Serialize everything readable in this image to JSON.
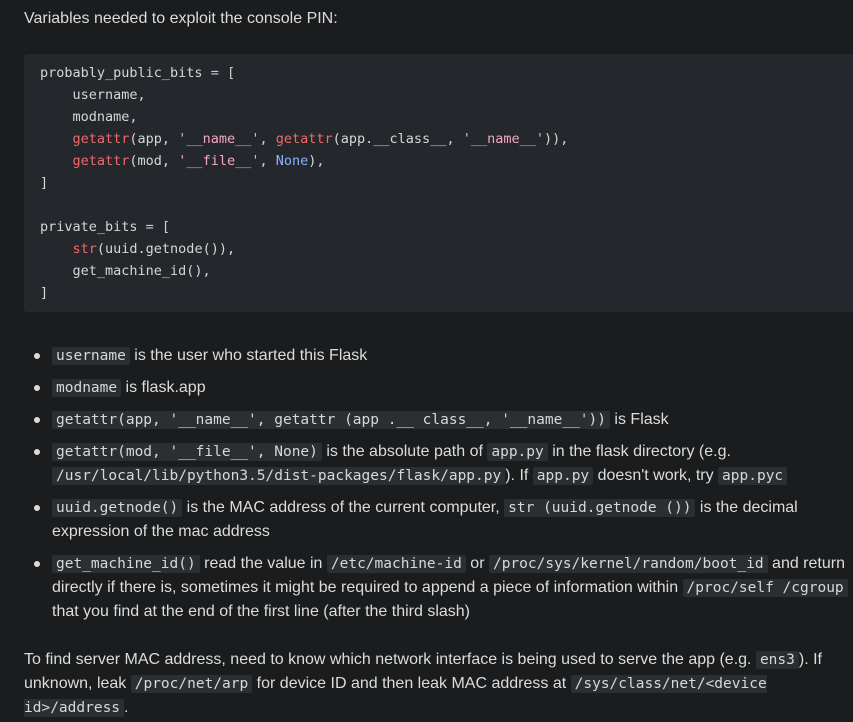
{
  "intro_text": "Variables needed to exploit the console PIN:",
  "code_lines": [
    [
      {
        "t": "probably_public_bits ",
        "c": ""
      },
      {
        "t": "= [",
        "c": "op"
      }
    ],
    [
      {
        "t": "    username,",
        "c": ""
      }
    ],
    [
      {
        "t": "    modname,",
        "c": ""
      }
    ],
    [
      {
        "t": "    ",
        "c": ""
      },
      {
        "t": "getattr",
        "c": "fn"
      },
      {
        "t": "(app, ",
        "c": ""
      },
      {
        "t": "'__name__'",
        "c": "str"
      },
      {
        "t": ", ",
        "c": ""
      },
      {
        "t": "getattr",
        "c": "fn"
      },
      {
        "t": "(app.__class__, ",
        "c": ""
      },
      {
        "t": "'__name__'",
        "c": "str"
      },
      {
        "t": ")),",
        "c": ""
      }
    ],
    [
      {
        "t": "    ",
        "c": ""
      },
      {
        "t": "getattr",
        "c": "fn"
      },
      {
        "t": "(mod, ",
        "c": ""
      },
      {
        "t": "'__file__'",
        "c": "str"
      },
      {
        "t": ", ",
        "c": ""
      },
      {
        "t": "None",
        "c": "kw"
      },
      {
        "t": "),",
        "c": ""
      }
    ],
    [
      {
        "t": "]",
        "c": ""
      }
    ],
    [
      {
        "t": "",
        "c": ""
      }
    ],
    [
      {
        "t": "private_bits ",
        "c": ""
      },
      {
        "t": "= [",
        "c": "op"
      }
    ],
    [
      {
        "t": "    ",
        "c": ""
      },
      {
        "t": "str",
        "c": "fn"
      },
      {
        "t": "(uuid.getnode()),",
        "c": ""
      }
    ],
    [
      {
        "t": "    get_machine_id(),",
        "c": ""
      }
    ],
    [
      {
        "t": "]",
        "c": ""
      }
    ]
  ],
  "bullets": [
    [
      {
        "code": "username"
      },
      {
        "text": " is the user who started this Flask"
      }
    ],
    [
      {
        "code": "modname"
      },
      {
        "text": " is flask.app"
      }
    ],
    [
      {
        "code": "getattr(app, '__name__', getattr (app .__ class__, '__name__'))"
      },
      {
        "text": " is Flask"
      }
    ],
    [
      {
        "code": "getattr(mod, '__file__', None)"
      },
      {
        "text": " is the absolute path of "
      },
      {
        "code": "app.py"
      },
      {
        "text": " in the flask directory (e.g. "
      },
      {
        "code": "/usr/local/lib/python3.5/dist-packages/flask/app.py"
      },
      {
        "text": "). If "
      },
      {
        "code": "app.py"
      },
      {
        "text": " doesn't work, try "
      },
      {
        "code": "app.pyc"
      }
    ],
    [
      {
        "code": "uuid.getnode()"
      },
      {
        "text": " is the MAC address of the current computer, "
      },
      {
        "code": "str (uuid.getnode ())"
      },
      {
        "text": " is the decimal expression of the mac address"
      }
    ],
    [
      {
        "code": "get_machine_id()"
      },
      {
        "text": " read the value in "
      },
      {
        "code": "/etc/machine-id"
      },
      {
        "text": " or "
      },
      {
        "code": "/proc/sys/kernel/random/boot_id"
      },
      {
        "text": " and return directly if there is, sometimes it might be required to append a piece of information within "
      },
      {
        "code": "/proc/self /cgroup"
      },
      {
        "text": " that you find at the end of the first line (after the third slash)"
      }
    ]
  ],
  "footer": [
    {
      "text": "To find server MAC address, need to know which network interface is being used to serve the app (e.g. "
    },
    {
      "code": "ens3"
    },
    {
      "text": "). If unknown, leak "
    },
    {
      "code": "/proc/net/arp"
    },
    {
      "text": " for device ID and then leak MAC address at "
    },
    {
      "code": "/sys/class/net/<device id>/address"
    },
    {
      "text": "."
    }
  ],
  "colors": {
    "background": "#1a1c1e",
    "code_block_bg": "#24272b",
    "inline_code_bg": "#2b2e32",
    "function": "#f0696a",
    "string": "#f3a9c4",
    "keyword": "#8cb2ff",
    "text": "#dcdcdc"
  }
}
